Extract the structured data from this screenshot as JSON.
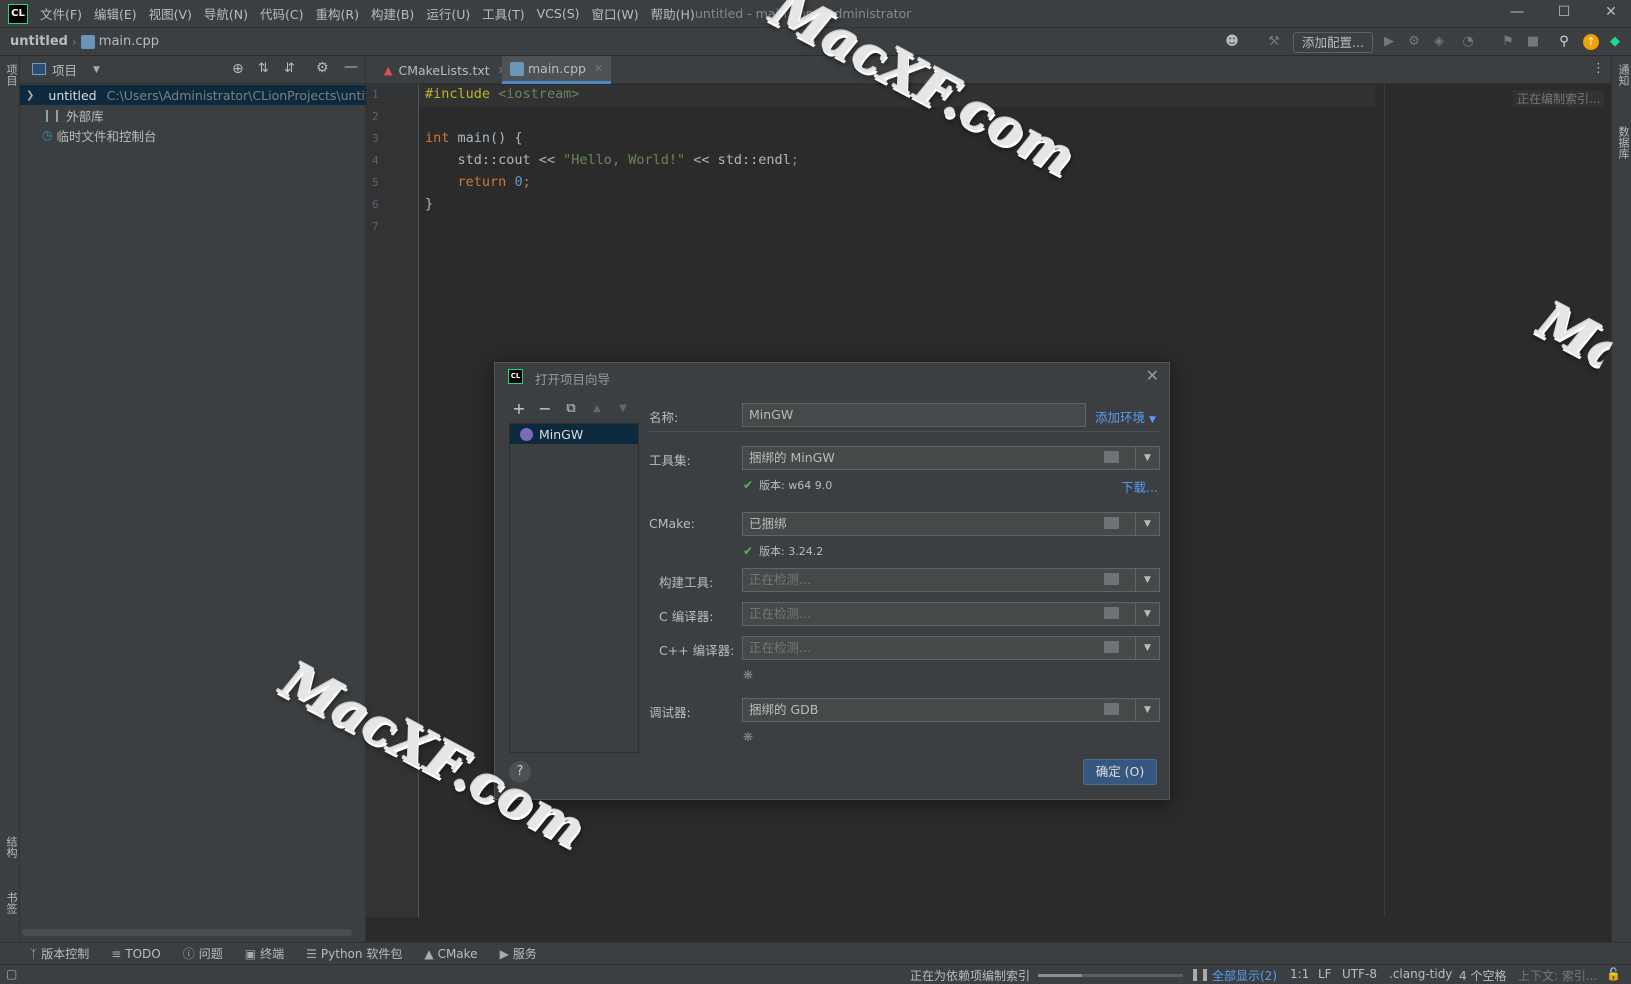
{
  "app": {
    "logo": "CL",
    "window_title": "untitled - main.cpp - Administrator"
  },
  "menu": [
    "文件(F)",
    "编辑(E)",
    "视图(V)",
    "导航(N)",
    "代码(C)",
    "重构(R)",
    "构建(B)",
    "运行(U)",
    "工具(T)",
    "VCS(S)",
    "窗口(W)",
    "帮助(H)"
  ],
  "navbar": {
    "project": "untitled",
    "file": "main.cpp",
    "add_config": "添加配置..."
  },
  "left_strip": {
    "project": "项目",
    "structure": "结构",
    "bookmarks": "书签"
  },
  "right_strip": {
    "notifications": "通知",
    "database": "数据库"
  },
  "project_panel": {
    "title": "项目",
    "tree": [
      {
        "name": "untitled",
        "path": "C:\\Users\\Administrator\\CLionProjects\\untitled"
      },
      {
        "name": "外部库"
      },
      {
        "name": "临时文件和控制台"
      }
    ]
  },
  "tabs": [
    {
      "label": "CMakeLists.txt"
    },
    {
      "label": "main.cpp"
    }
  ],
  "editor": {
    "line_numbers": [
      "1",
      "2",
      "3",
      "4",
      "5",
      "6",
      "7"
    ],
    "indexing_note": "正在编制索引..."
  },
  "dialog": {
    "title": "打开项目向导",
    "toolchain_list": [
      "MinGW"
    ],
    "name_label": "名称:",
    "name_value": "MinGW",
    "add_env": "添加环境",
    "toolset_label": "工具集:",
    "toolset_value": "捆绑的 MinGW",
    "toolset_version": "版本: w64 9.0",
    "download": "下载...",
    "cmake_label": "CMake:",
    "cmake_value": "已捆绑",
    "cmake_version": "版本: 3.24.2",
    "build_tool_label": "构建工具:",
    "c_compiler_label": "C 编译器:",
    "cpp_compiler_label": "C++ 编译器:",
    "detecting": "正在检测...",
    "debugger_label": "调试器:",
    "debugger_value": "捆绑的 GDB",
    "help": "?",
    "ok": "确定 (O)"
  },
  "bottom_tools": [
    "版本控制",
    "TODO",
    "问题",
    "终端",
    "Python 软件包",
    "CMake",
    "服务"
  ],
  "statusbar": {
    "task": "正在为依赖项编制索引",
    "show_all": "全部显示(2)",
    "position": "1:1",
    "line_sep": "LF",
    "encoding": "UTF-8",
    "linter": ".clang-tidy",
    "indent": "4 个空格",
    "context": "上下文: 索引..."
  },
  "watermark": "MacXF.com"
}
